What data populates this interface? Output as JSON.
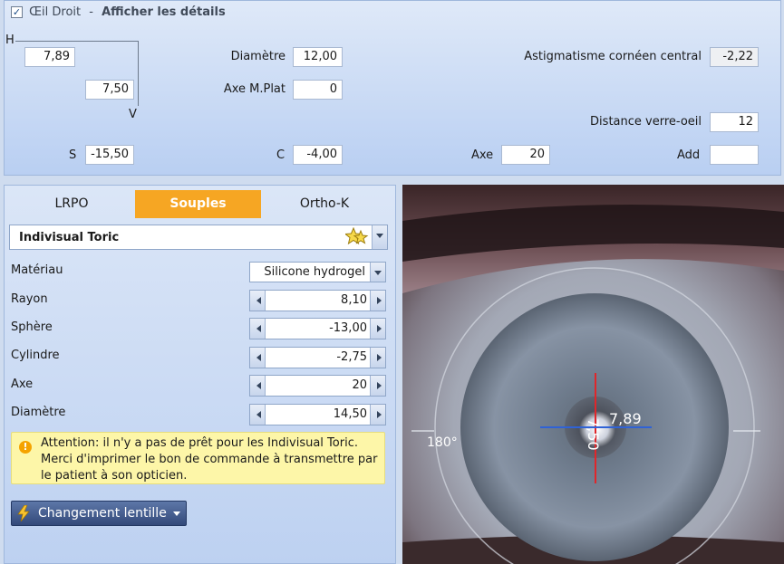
{
  "header": {
    "eye_checked": true,
    "eye_label": "Œil Droit",
    "separator": "-",
    "details_link": "Afficher les détails"
  },
  "keratometry": {
    "h_label": "H",
    "v_label": "V",
    "h_value": "7,89",
    "v_value": "7,50"
  },
  "diametre": {
    "label": "Diamètre",
    "value": "12,00"
  },
  "axe_mplat": {
    "label": "Axe M.Plat",
    "value": "0"
  },
  "astig": {
    "label": "Astigmatisme cornéen central",
    "value": "-2,22"
  },
  "distance": {
    "label": "Distance verre-oeil",
    "value": "12"
  },
  "refraction": {
    "s_label": "S",
    "s_value": "-15,50",
    "c_label": "C",
    "c_value": "-4,00",
    "axe_label": "Axe",
    "axe_value": "20",
    "add_label": "Add",
    "add_value": ""
  },
  "tabs": [
    {
      "label": "LRPO",
      "active": false
    },
    {
      "label": "Souples",
      "active": true
    },
    {
      "label": "Ortho-K",
      "active": false
    }
  ],
  "lens": {
    "name": "Indivisual Toric"
  },
  "params": {
    "materiau": {
      "label": "Matériau",
      "value": "Silicone hydrogel"
    },
    "rayon": {
      "label": "Rayon",
      "value": "8,10"
    },
    "sphere": {
      "label": "Sphère",
      "value": "-13,00"
    },
    "cylindre": {
      "label": "Cylindre",
      "value": "-2,75"
    },
    "axe": {
      "label": "Axe",
      "value": "20"
    },
    "diametre": {
      "label": "Diamètre",
      "value": "14,50"
    }
  },
  "warning": {
    "line1": "Attention: il n'y a pas de prêt pour les Indivisual Toric.",
    "line2": "Merci d'imprimer le bon de commande à transmettre par",
    "line3": "le patient à son opticien."
  },
  "change_button": {
    "label": "Changement lentille"
  },
  "eye_image": {
    "vertical_label": "7,50",
    "horizontal_label": "7,89",
    "angle_label": "180°",
    "colors": {
      "vertical_line": "#e0262a",
      "horizontal_line": "#2f62d6"
    }
  },
  "colors": {
    "accent": "#f6a623",
    "panel": "#c8d9f3"
  }
}
